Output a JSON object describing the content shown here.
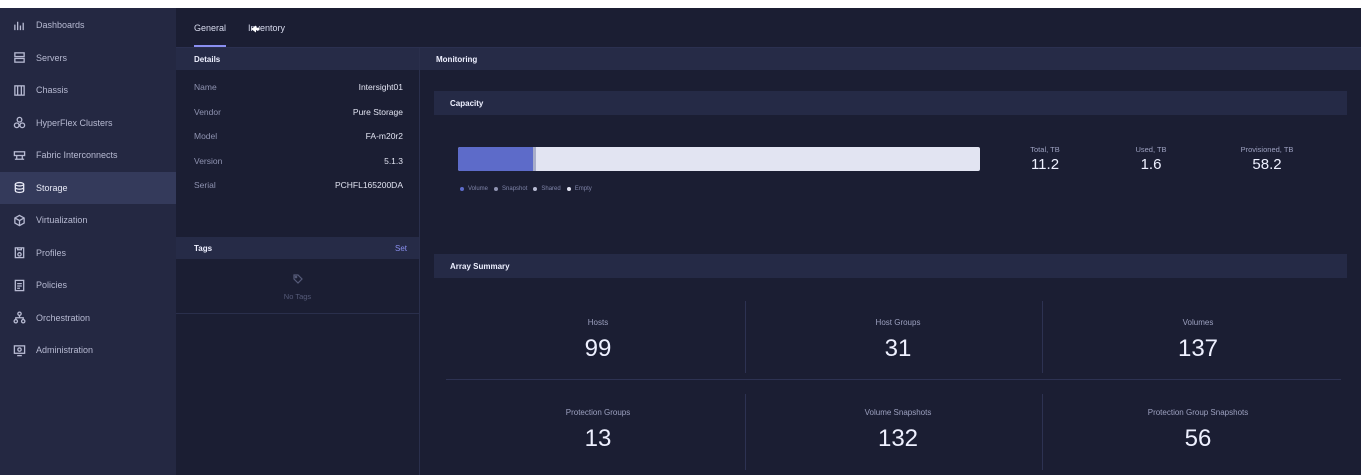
{
  "sidebar": {
    "items": [
      {
        "label": "Dashboards",
        "icon": "dashboards-icon"
      },
      {
        "label": "Servers",
        "icon": "servers-icon"
      },
      {
        "label": "Chassis",
        "icon": "chassis-icon"
      },
      {
        "label": "HyperFlex Clusters",
        "icon": "hyperflex-icon"
      },
      {
        "label": "Fabric Interconnects",
        "icon": "fabric-icon"
      },
      {
        "label": "Storage",
        "icon": "storage-icon",
        "active": true
      },
      {
        "label": "Virtualization",
        "icon": "virtualization-icon"
      },
      {
        "label": "Profiles",
        "icon": "profiles-icon"
      },
      {
        "label": "Policies",
        "icon": "policies-icon"
      },
      {
        "label": "Orchestration",
        "icon": "orchestration-icon"
      },
      {
        "label": "Administration",
        "icon": "administration-icon"
      }
    ]
  },
  "tabs": [
    {
      "label": "General",
      "active": true
    },
    {
      "label": "Inventory"
    }
  ],
  "details": {
    "title": "Details",
    "rows": [
      {
        "key": "Name",
        "value": "Intersight01"
      },
      {
        "key": "Vendor",
        "value": "Pure Storage"
      },
      {
        "key": "Model",
        "value": "FA-m20r2"
      },
      {
        "key": "Version",
        "value": "5.1.3"
      },
      {
        "key": "Serial",
        "value": "PCHFL165200DA"
      }
    ]
  },
  "tags": {
    "title": "Tags",
    "action": "Set",
    "empty": "No Tags"
  },
  "monitoring": {
    "title": "Monitoring",
    "capacity": {
      "title": "Capacity",
      "used_fraction": 0.143,
      "legend": [
        {
          "label": "Volume",
          "color": "#5d6bc9"
        },
        {
          "label": "Snapshot",
          "color": "#8f93b1"
        },
        {
          "label": "Shared",
          "color": "#b7bad2"
        },
        {
          "label": "Empty",
          "color": "#e2e4f2"
        }
      ],
      "metrics": [
        {
          "label": "Total, TB",
          "value": "11.2"
        },
        {
          "label": "Used, TB",
          "value": "1.6"
        },
        {
          "label": "Provisioned, TB",
          "value": "58.2"
        }
      ]
    },
    "array_summary": {
      "title": "Array Summary",
      "cells": [
        {
          "label": "Hosts",
          "value": "99"
        },
        {
          "label": "Host Groups",
          "value": "31"
        },
        {
          "label": "Volumes",
          "value": "137"
        },
        {
          "label": "Protection Groups",
          "value": "13"
        },
        {
          "label": "Volume Snapshots",
          "value": "132"
        },
        {
          "label": "Protection Group Snapshots",
          "value": "56"
        }
      ]
    }
  },
  "colors": {
    "accent": "#8a8ff0",
    "bar_used": "#5d6bc9",
    "bar_empty": "#e2e4f2",
    "background": "#1b1e33",
    "sidebar": "#242842"
  }
}
